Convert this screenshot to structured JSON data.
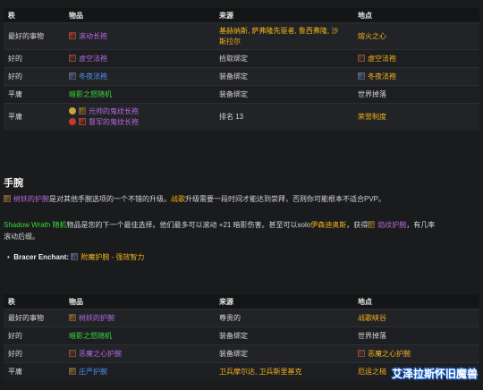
{
  "table1": {
    "headers": [
      "秩",
      "物品",
      "来源",
      "地点"
    ],
    "rows": [
      {
        "rank": "最好的事物",
        "item": "滚动长袍",
        "source_l1": "基赫纳斯, 萨弗隆先驱者, 鲁西弗隆, 沙",
        "source_l2": "斯拉尔",
        "location": "熔火之心"
      },
      {
        "rank": "好的",
        "item": "虚空法袍",
        "source": "拾取绑定",
        "location": "虚空法袍"
      },
      {
        "rank": "好的",
        "item": "冬夜法袍",
        "source": "装备绑定",
        "location": "冬夜法袍"
      },
      {
        "rank": "平庸",
        "item": "暗影之怒随机",
        "source": "装备绑定",
        "location": "世界掉落"
      },
      {
        "rank": "平庸",
        "item_a": "元帅的鬼纹长袍",
        "item_b": "督军的鬼纹长袍",
        "source": "排名 13",
        "location": "荣誉制度"
      }
    ]
  },
  "section": {
    "heading": "手腕",
    "p1_item": "树妖的护腕",
    "p1_mid": "是对其他手腕选项的一个不错的升级。",
    "p1_war": "战歌",
    "p1_end": "升级需要一段时间才能达到崇拜，否则你可能根本不适合PVP。",
    "p2_item": "Shadow Wrath 随机",
    "p2_mid": "物品是您的下一个最佳选择。他们最多可以滚动 +21 暗影伤害。甚至可以solo",
    "p2_boss": "伊森迪奥斯",
    "p2_get": "，获得",
    "p2_item2": "焰纹护腕",
    "p2_end": "，有几率",
    "p2_line2": "滚动后缀。",
    "bullet_label": "Bracer Enchant:",
    "bullet_value": "附魔护腕 - 强效智力"
  },
  "table2": {
    "headers": [
      "秩",
      "物品",
      "来源",
      "地点"
    ],
    "rows": [
      {
        "rank": "最好的事物",
        "item": "树妖的护腕",
        "source": "尊贵的",
        "location": "战歌峡谷"
      },
      {
        "rank": "好的",
        "item": "暗影之怒随机",
        "source": "装备绑定",
        "location": "世界掉落"
      },
      {
        "rank": "好的",
        "item": "恶魔之心护腕",
        "source": "装备绑定",
        "location": "恶魔之心护腕"
      },
      {
        "rank": "平庸",
        "item": "庄严护腕",
        "source": "卫兵摩尔达, 卫兵斯里基克",
        "location": "厄运之槌"
      }
    ]
  },
  "watermark": "艾泽拉斯怀旧魔兽",
  "colors": {
    "epic": "#b46ae0",
    "rare": "#4d8ff0",
    "legendary_gold": "#f3b21a",
    "uncommon": "#3ad93a"
  }
}
